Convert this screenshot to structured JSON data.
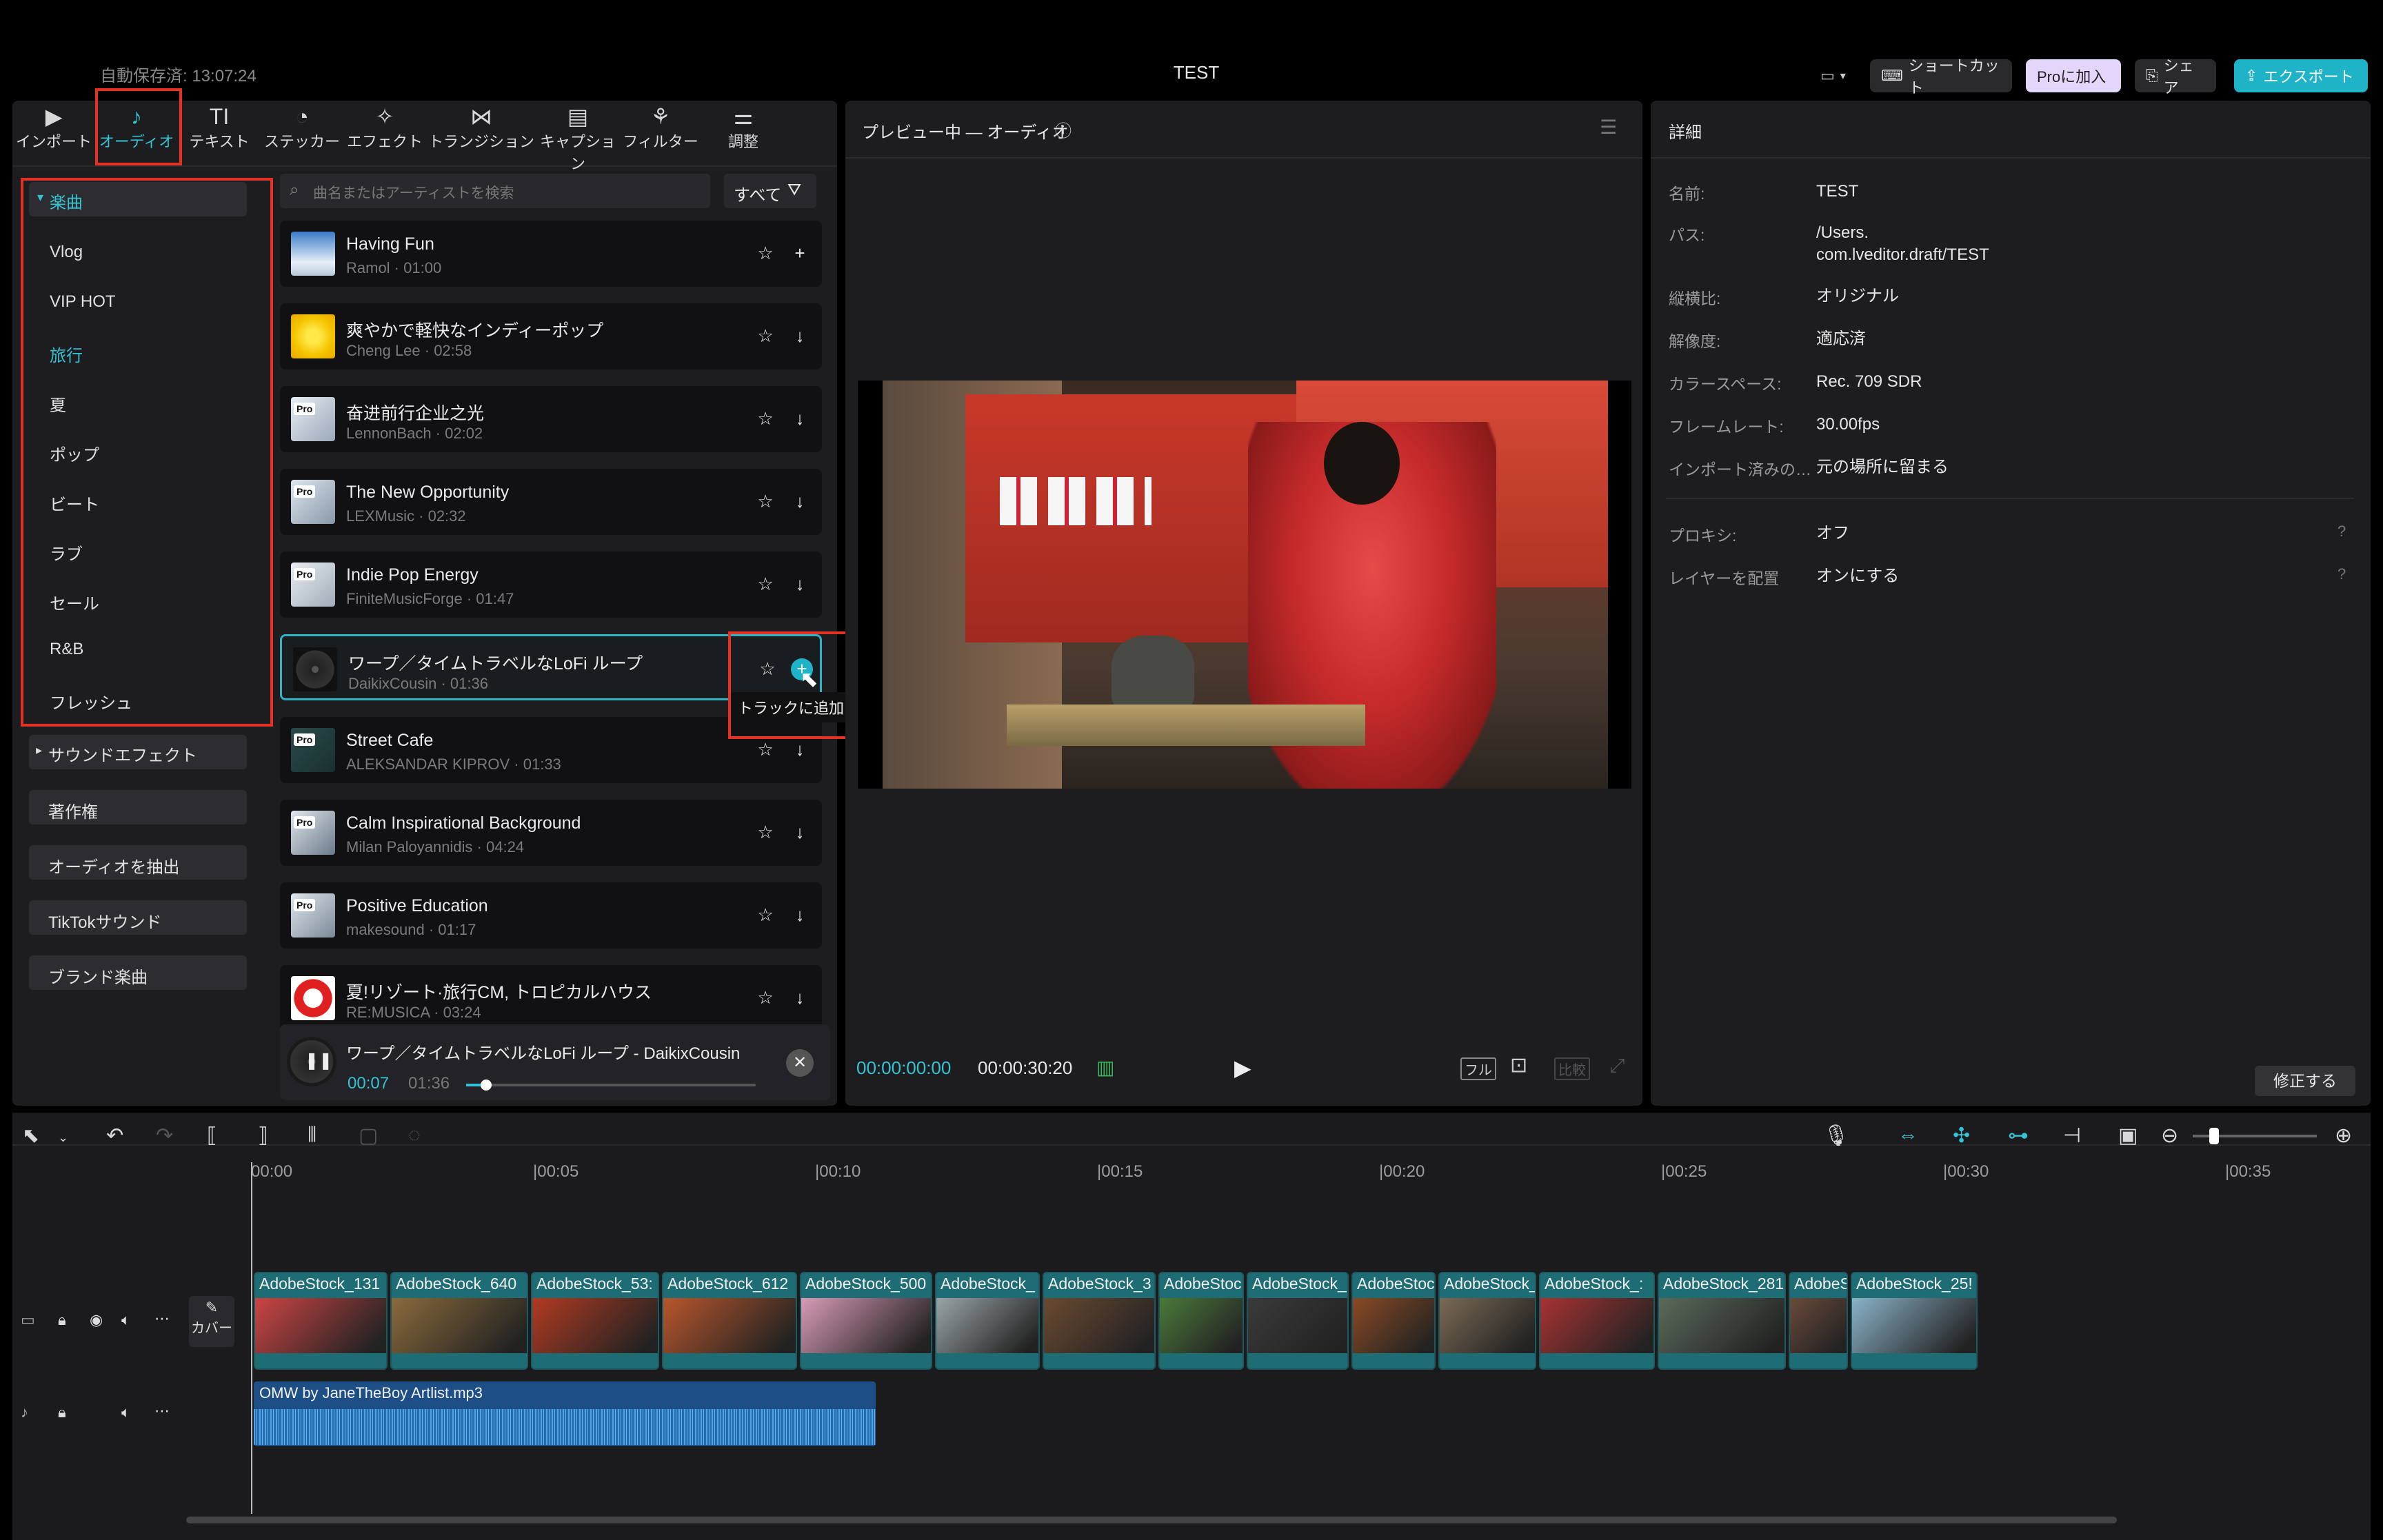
{
  "window": {
    "autosave": "自動保存済: 13:07:24",
    "title": "TEST"
  },
  "topbar": {
    "shortcut": "ショートカット",
    "pro": "Proに加入",
    "share": "シェア",
    "export": "エクスポート"
  },
  "tabs": [
    {
      "label": "インポート",
      "icon": "import-icon",
      "glyph": "▶"
    },
    {
      "label": "オーディオ",
      "icon": "audio-icon",
      "glyph": "♪"
    },
    {
      "label": "テキスト",
      "icon": "text-icon",
      "glyph": "TI"
    },
    {
      "label": "ステッカー",
      "icon": "sticker-icon",
      "glyph": "◔"
    },
    {
      "label": "エフェクト",
      "icon": "effects-icon",
      "glyph": "✧"
    },
    {
      "label": "トランジション",
      "icon": "transition-icon",
      "glyph": "⋈"
    },
    {
      "label": "キャプション",
      "icon": "caption-icon",
      "glyph": "▤"
    },
    {
      "label": "フィルター",
      "icon": "filter-icon",
      "glyph": "⚘"
    },
    {
      "label": "調整",
      "icon": "adjust-icon",
      "glyph": "⚌"
    }
  ],
  "categories": {
    "header": "楽曲",
    "items": [
      "Vlog",
      "VIP HOT",
      "旅行",
      "夏",
      "ポップ",
      "ビート",
      "ラブ",
      "セール",
      "R&B",
      "フレッシュ"
    ],
    "active": "旅行",
    "sound_effects": "サウンドエフェクト",
    "buttons": [
      "著作権",
      "オーディオを抽出",
      "TikTokサウンド",
      "ブランド楽曲"
    ]
  },
  "search": {
    "placeholder": "曲名またはアーティストを検索",
    "filter": "すべて"
  },
  "tracks": [
    {
      "title": "Having Fun",
      "sub": "Ramol · 01:00",
      "pro": false,
      "action": "+"
    },
    {
      "title": "爽やかで軽快なインディーポップ",
      "sub": "Cheng Lee · 02:58",
      "pro": false,
      "action": "↓"
    },
    {
      "title": "奋进前行企业之光",
      "sub": "LennonBach · 02:02",
      "pro": true,
      "action": "↓"
    },
    {
      "title": "The New Opportunity",
      "sub": "LEXMusic · 02:32",
      "pro": true,
      "action": "↓"
    },
    {
      "title": "Indie Pop Energy",
      "sub": "FiniteMusicForge · 01:47",
      "pro": true,
      "action": "↓"
    },
    {
      "title": "ワープ／タイムトラベルなLoFi ループ",
      "sub": "DaikixCousin · 01:36",
      "pro": false,
      "action": "+"
    },
    {
      "title": "Street Cafe",
      "sub": "ALEKSANDAR KIPROV · 01:33",
      "pro": true,
      "action": "↓"
    },
    {
      "title": "Calm Inspirational Background",
      "sub": "Milan Paloyannidis · 04:24",
      "pro": true,
      "action": "↓"
    },
    {
      "title": "Positive Education",
      "sub": "makesound · 01:17",
      "pro": true,
      "action": "↓"
    },
    {
      "title": "夏!リゾート·旅行CM, トロピカルハウス",
      "sub": "RE:MUSICA · 03:24",
      "pro": false,
      "action": "↓"
    }
  ],
  "tooltip": "トラックに追加",
  "player": {
    "title": "ワープ／タイムトラベルなLoFi ループ - DaikixCousin",
    "current": "00:07",
    "total": "01:36",
    "progress": 0.07
  },
  "preview": {
    "title": "プレビュー中 — オーディオ",
    "timecode": "00:00:00:00",
    "duration": "00:00:30:20",
    "full": "フル",
    "compare": "比較"
  },
  "details": {
    "title": "詳細",
    "rows": [
      {
        "k": "名前:",
        "v": "TEST"
      },
      {
        "k": "パス:",
        "v": "/Users.\ncom.lveditor.draft/TEST"
      },
      {
        "k": "縦横比:",
        "v": "オリジナル"
      },
      {
        "k": "解像度:",
        "v": "適応済"
      },
      {
        "k": "カラースペース:",
        "v": "Rec. 709 SDR"
      },
      {
        "k": "フレームレート:",
        "v": "30.00fps"
      },
      {
        "k": "インポート済みの…",
        "v": "元の場所に留まる"
      },
      {
        "k": "プロキシ:",
        "v": "オフ"
      },
      {
        "k": "レイヤーを配置",
        "v": "オンにする"
      }
    ],
    "modify": "修正する"
  },
  "timeline": {
    "ticks": [
      "00:00",
      "|00:05",
      "|00:10",
      "|00:15",
      "|00:20",
      "|00:25",
      "|00:30",
      "|00:35"
    ],
    "cover": "カバー",
    "clips": [
      {
        "label": "AdobeStock_131",
        "color": "#c44"
      },
      {
        "label": "AdobeStock_640",
        "color": "#8a6a3c"
      },
      {
        "label": "AdobeStock_53:",
        "color": "#b23a22"
      },
      {
        "label": "AdobeStock_612",
        "color": "#b8562c"
      },
      {
        "label": "AdobeStock_500",
        "color": "#d89ab6"
      },
      {
        "label": "AdobeStock_",
        "color": "#9aa4a6"
      },
      {
        "label": "AdobeStock_3",
        "color": "#6a4a30"
      },
      {
        "label": "AdobeStoc",
        "color": "#4a7a3a"
      },
      {
        "label": "AdobeStock_",
        "color": "#3a3a3a"
      },
      {
        "label": "AdobeStoc",
        "color": "#8a4a24"
      },
      {
        "label": "AdobeStock_",
        "color": "#7a6a54"
      },
      {
        "label": "AdobeStock_:",
        "color": "#a83232"
      },
      {
        "label": "AdobeStock_281",
        "color": "#5a6a5a"
      },
      {
        "label": "AdobeS",
        "color": "#6a4a3a"
      },
      {
        "label": "AdobeStock_25!",
        "color": "#8ab2c8"
      }
    ],
    "audio": "OMW by JaneTheBoy Artlist.mp3"
  },
  "colors": {
    "accent": "#33c3d4",
    "export": "#1fb3c8",
    "pro": "#c6a8f5",
    "highlight": "#e33124"
  }
}
